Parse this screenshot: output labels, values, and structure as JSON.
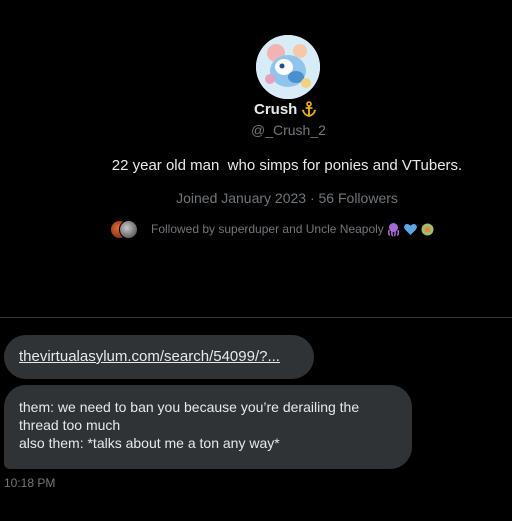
{
  "profile": {
    "avatar_icon": "profile-avatar",
    "display_name": "Crush",
    "badge_icon": "anchor-icon",
    "handle": "@_Crush_2",
    "bio": "22 year old man  who simps for ponies and VTubers.",
    "joined": "Joined January 2023 · 56 Followers",
    "followed_by": "Followed by superduper and Uncle Neapoly",
    "followed_by_emojis": [
      "octopus-emoji",
      "blue-heart-emoji",
      "orb-emoji"
    ]
  },
  "messages": [
    {
      "type": "link",
      "text": "thevirtualasylum.com/search/54099/?..."
    },
    {
      "type": "text",
      "lines": [
        "them: we need to ban you because you’re derailing the",
        "thread too much",
        "also them: *talks about me a ton any way*"
      ]
    }
  ],
  "timestamp": "10:18 PM",
  "colors": {
    "background": "#000000",
    "bubble": "#2f3336",
    "text": "#e7e9ea",
    "muted": "#71767b",
    "accent_gold": "#f4b400"
  }
}
